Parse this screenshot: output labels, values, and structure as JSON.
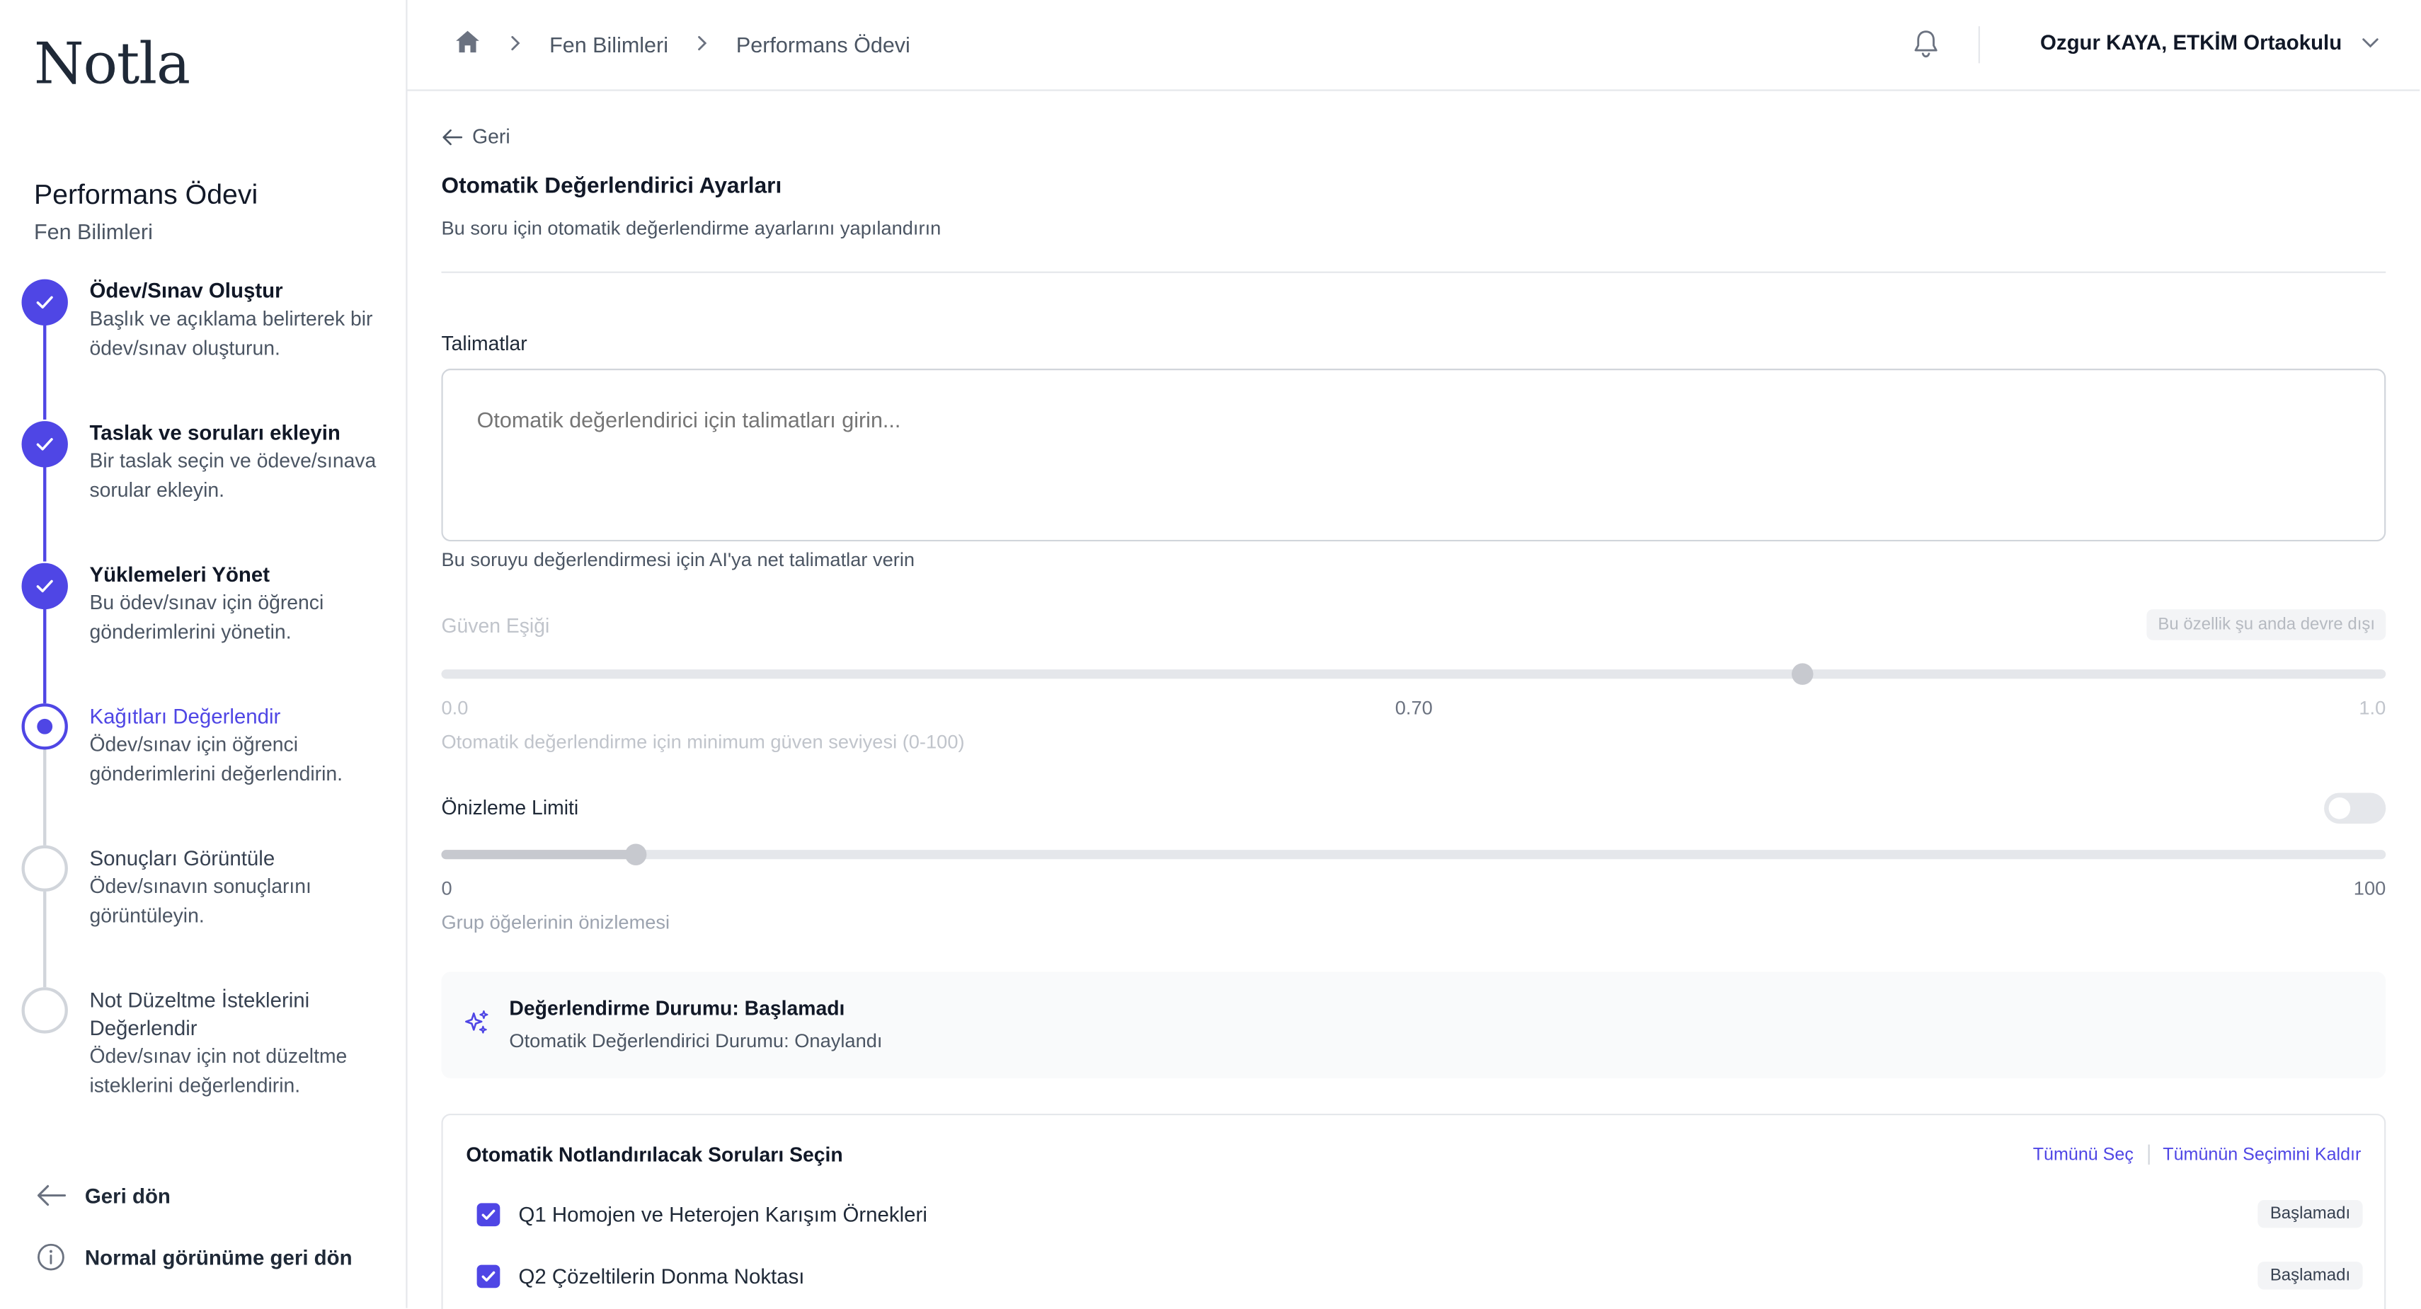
{
  "app": {
    "logo": "Notla"
  },
  "sidebar": {
    "title": "Performans Ödevi",
    "subtitle": "Fen Bilimleri",
    "steps": [
      {
        "title": "Ödev/Sınav Oluştur",
        "desc": "Başlık ve açıklama belirterek bir ödev/sınav oluşturun.",
        "state": "done"
      },
      {
        "title": "Taslak ve soruları ekleyin",
        "desc": "Bir taslak seçin ve ödeve/sınava sorular ekleyin.",
        "state": "done"
      },
      {
        "title": "Yüklemeleri Yönet",
        "desc": "Bu ödev/sınav için öğrenci gönderimlerini yönetin.",
        "state": "done"
      },
      {
        "title": "Kağıtları Değerlendir",
        "desc": "Ödev/sınav için öğrenci gönderimlerini değerlendirin.",
        "state": "current"
      },
      {
        "title": "Sonuçları Görüntüle",
        "desc": "Ödev/sınavın sonuçlarını görüntüleyin.",
        "state": "todo"
      },
      {
        "title": "Not Düzeltme İsteklerini Değerlendir",
        "desc": "Ödev/sınav için not düzeltme isteklerini değerlendirin.",
        "state": "todo"
      }
    ],
    "back_label": "Geri dön",
    "normal_view_label": "Normal görünüme geri dön"
  },
  "header": {
    "breadcrumb": [
      "Fen Bilimleri",
      "Performans Ödevi"
    ],
    "user": "Ozgur KAYA, ETKİM Ortaokulu"
  },
  "main": {
    "back_label": "Geri",
    "title": "Otomatik Değerlendirici Ayarları",
    "subtitle": "Bu soru için otomatik değerlendirme ayarlarını yapılandırın",
    "instructions": {
      "label": "Talimatlar",
      "placeholder": "Otomatik değerlendirici için talimatları girin...",
      "hint": "Bu soruyu değerlendirmesi için AI'ya net talimatlar verin"
    },
    "confidence": {
      "label": "Güven Eşiği",
      "disabled_badge": "Bu özellik şu anda devre dışı",
      "min_label": "0.0",
      "value_label": "0.70",
      "max_label": "1.0",
      "value": 0.7,
      "min": 0,
      "max": 1,
      "hint": "Otomatik değerlendirme için minimum güven seviyesi (0-100)"
    },
    "preview": {
      "label": "Önizleme Limiti",
      "toggle_on": false,
      "min_label": "0",
      "max_label": "100",
      "value": 10,
      "min": 0,
      "max": 100,
      "hint": "Grup öğelerinin önizlemesi"
    },
    "status": {
      "title": "Değerlendirme Durumu: Başlamadı",
      "subtitle": "Otomatik Değerlendirici Durumu: Onaylandı"
    },
    "questions": {
      "title": "Otomatik Notlandırılacak Soruları Seçin",
      "select_all": "Tümünü Seç",
      "deselect_all": "Tümünün Seçimini Kaldır",
      "items": [
        {
          "label": "Q1 Homojen ve Heterojen Karışım Örnekleri",
          "checked": true,
          "badge": "Başlamadı"
        },
        {
          "label": "Q2 Çözeltilerin Donma Noktası",
          "checked": true,
          "badge": "Başlamadı"
        }
      ]
    }
  },
  "colors": {
    "accent": "#4f46e5",
    "border": "#e5e7eb",
    "muted": "#4b5563"
  }
}
